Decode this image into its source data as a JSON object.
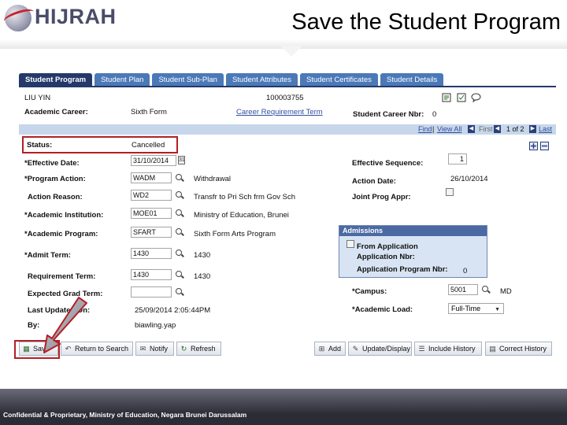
{
  "header": {
    "logo_text": "HIJRAH",
    "slide_title": "Save the Student Program"
  },
  "tabs": [
    {
      "label": "Student Program",
      "active": true
    },
    {
      "label": "Student Plan"
    },
    {
      "label": "Student Sub-Plan"
    },
    {
      "label": "Student Attributes"
    },
    {
      "label": "Student Certificates"
    },
    {
      "label": "Student Details"
    }
  ],
  "student": {
    "name": "LIU YIN",
    "id": "100003755",
    "academic_career_label": "Academic Career:",
    "academic_career_value": "Sixth Form",
    "career_requirement_term_link": "Career Requirement Term",
    "student_career_nbr_label": "Student Career Nbr:",
    "student_career_nbr_value": "0"
  },
  "navbar": {
    "find": "Find",
    "view_all": "View All",
    "first": "First",
    "count": "1 of 2",
    "last": "Last"
  },
  "form": {
    "status_label": "Status:",
    "status_value": "Cancelled",
    "effective_date_label": "*Effective Date:",
    "effective_date_value": "31/10/2014",
    "program_action_label": "*Program Action:",
    "program_action_value": "WADM",
    "program_action_desc": "Withdrawal",
    "action_reason_label": "Action Reason:",
    "action_reason_value": "WD2",
    "action_reason_desc": "Transfr to Pri Sch frm Gov Sch",
    "academic_institution_label": "*Academic Institution:",
    "academic_institution_value": "MOE01",
    "academic_institution_desc": "Ministry of Education, Brunei",
    "academic_program_label": "*Academic Program:",
    "academic_program_value": "SFART",
    "academic_program_desc": "Sixth Form Arts Program",
    "admit_term_label": "*Admit Term:",
    "admit_term_value": "1430",
    "admit_term_desc": "1430",
    "requirement_term_label": "Requirement Term:",
    "requirement_term_value": "1430",
    "requirement_term_desc": "1430",
    "expected_grad_term_label": "Expected Grad Term:",
    "expected_grad_term_value": "",
    "last_updated_label": "Last Updated On:",
    "last_updated_value": "25/09/2014  2:05:44PM",
    "by_label": "By:",
    "by_value": "biawling.yap",
    "effective_sequence_label": "Effective Sequence:",
    "effective_sequence_value": "1",
    "action_date_label": "Action Date:",
    "action_date_value": "26/10/2014",
    "joint_prog_appr_label": "Joint Prog Appr:",
    "campus_label": "*Campus:",
    "campus_value": "5001",
    "campus_desc": "MD",
    "academic_load_label": "*Academic Load:",
    "academic_load_value": "Full-Time"
  },
  "admissions": {
    "title": "Admissions",
    "from_application_label": "From Application",
    "application_nbr_label": "Application Nbr:",
    "application_program_nbr_label": "Application Program Nbr:",
    "application_program_nbr_value": "0"
  },
  "toolbar": {
    "save": "Save",
    "return_to_search": "Return to Search",
    "notify": "Notify",
    "refresh": "Refresh",
    "add": "Add",
    "update_display": "Update/Display",
    "include_history": "Include History",
    "correct_history": "Correct History"
  },
  "footer": {
    "text": "Confidential & Proprietary, Ministry of Education, Negara Brunei Darussalam"
  },
  "colors": {
    "tab_active": "#24386a",
    "tab_inactive": "#4b79b8",
    "highlight_red": "#b31f24"
  }
}
